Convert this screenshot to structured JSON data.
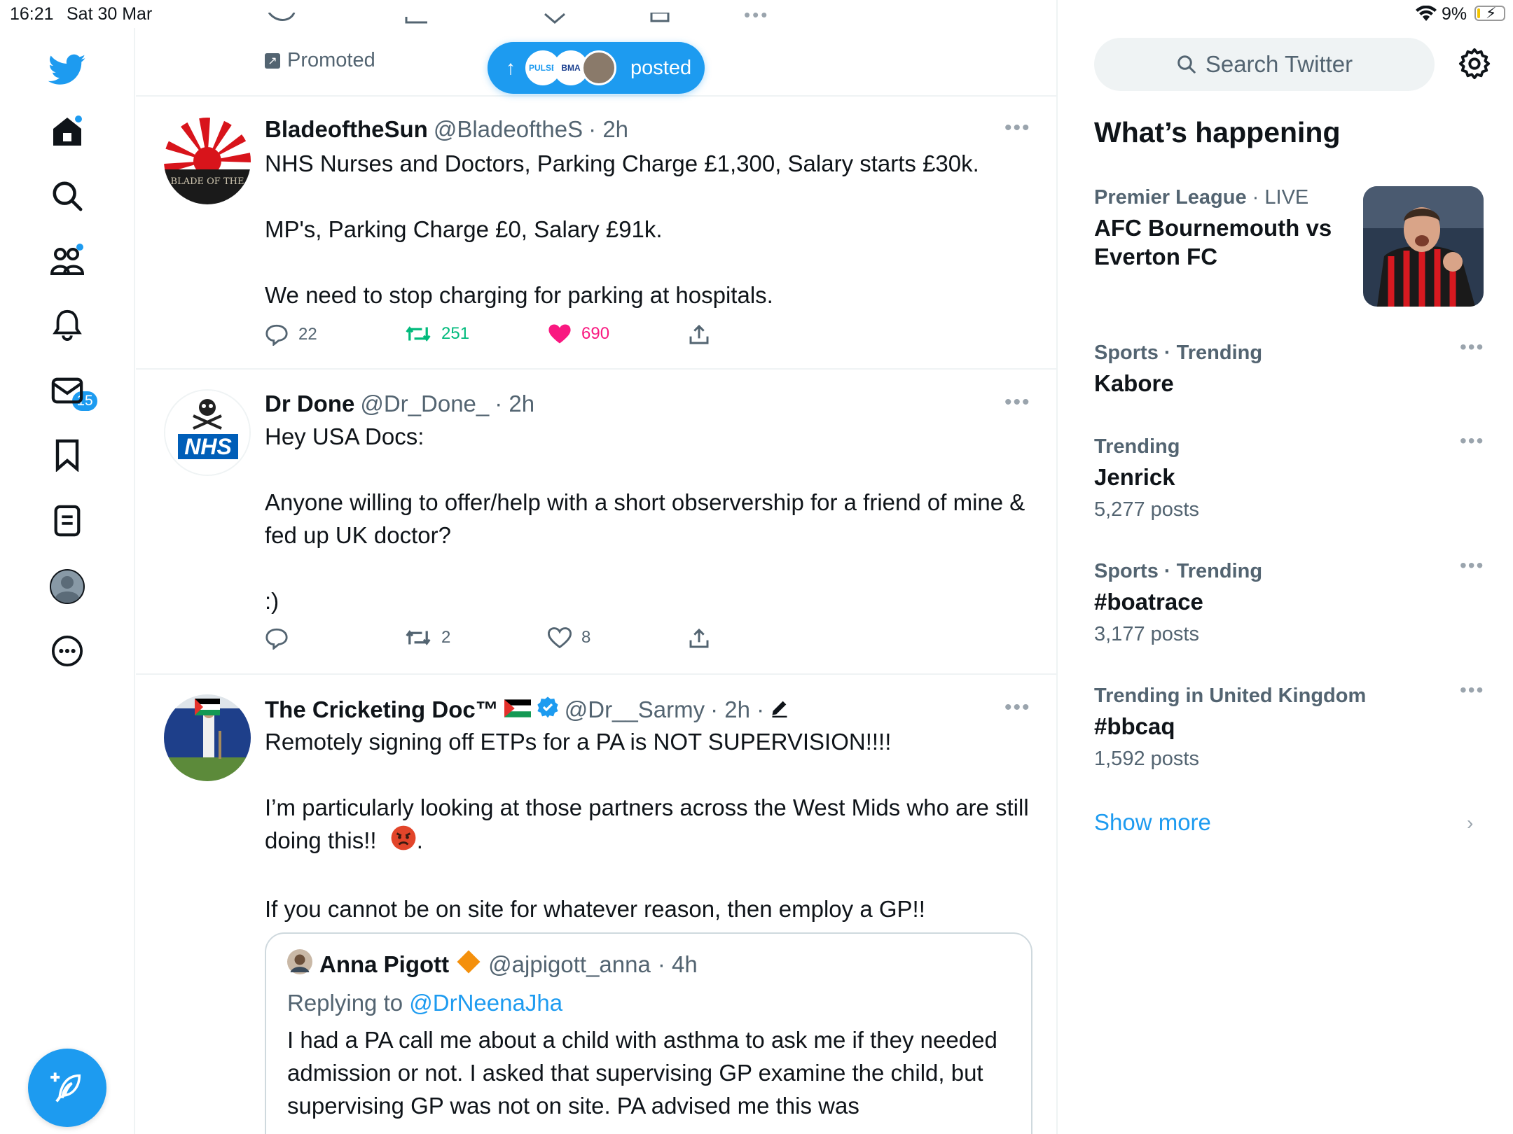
{
  "status_bar": {
    "time": "16:21",
    "date": "Sat 30 Mar",
    "battery": "9%"
  },
  "nav": {
    "notifications_badge": "15",
    "items": [
      "home-icon",
      "search-icon",
      "communities-icon",
      "notifications-icon",
      "messages-icon",
      "bookmarks-icon",
      "lists-icon",
      "profile-icon",
      "more-icon"
    ]
  },
  "timeline": {
    "promoted_label": "Promoted",
    "posted_pill": {
      "label": "posted",
      "avatar1": "PULSE",
      "avatar2": "BMA"
    },
    "tweets": [
      {
        "name": "BladeoftheSun",
        "handle": "@BladeoftheS",
        "time": "· 2h",
        "avatar_text": "BLADE OF THE",
        "text": [
          "NHS Nurses and Doctors, Parking Charge £1,300, Salary starts £30k.",
          "MP's, Parking Charge £0, Salary £91k.",
          "We need to stop charging for parking at hospitals."
        ],
        "replies": "22",
        "retweets": "251",
        "likes": "690"
      },
      {
        "name": "Dr Done",
        "handle": "@Dr_Done_",
        "time": "· 2h",
        "avatar_text": "NHS",
        "text": [
          "Hey USA Docs:",
          "Anyone willing to offer/help with a short observership for a friend of mine & fed up UK doctor?",
          ":)"
        ],
        "replies": "",
        "retweets": "2",
        "likes": "8"
      },
      {
        "name": "The Cricketing Doc™",
        "handle": "@Dr__Sarmy",
        "time": "· 2h ·",
        "text": [
          "Remotely signing off ETPs for a PA is NOT SUPERVISION!!!!",
          "I’m particularly looking at those partners across the West Mids who are still doing this!!",
          "If you cannot be on site for whatever reason, then employ a GP!!"
        ],
        "quote": {
          "name": "Anna Pigott",
          "handle": "@ajpigott_anna",
          "time": "· 4h",
          "replying_prefix": "Replying to",
          "replying_to": "@DrNeenaJha",
          "text": "I had a PA call me about a child with asthma to ask me if they needed admission or not. I asked that supervising GP examine the child, but supervising GP was not on site. PA advised me this was"
        }
      }
    ]
  },
  "sidebar": {
    "search_placeholder": "Search Twitter",
    "title": "What’s happening",
    "trends": [
      {
        "context": "Premier League",
        "live": "· LIVE",
        "topic": "AFC Bournemouth vs Everton FC",
        "count": ""
      },
      {
        "context": "Sports · Trending",
        "topic": "Kabore",
        "count": ""
      },
      {
        "context": "Trending",
        "topic": "Jenrick",
        "count": "5,277 posts"
      },
      {
        "context": "Sports · Trending",
        "topic": "#boatrace",
        "count": "3,177 posts"
      },
      {
        "context": "Trending in United Kingdom",
        "topic": "#bbcaq",
        "count": "1,592 posts"
      }
    ],
    "show_more": "Show more"
  },
  "colors": {
    "accent": "#1d9bf0",
    "like": "#f91880",
    "retweet": "#00ba7c",
    "muted": "#536471"
  }
}
